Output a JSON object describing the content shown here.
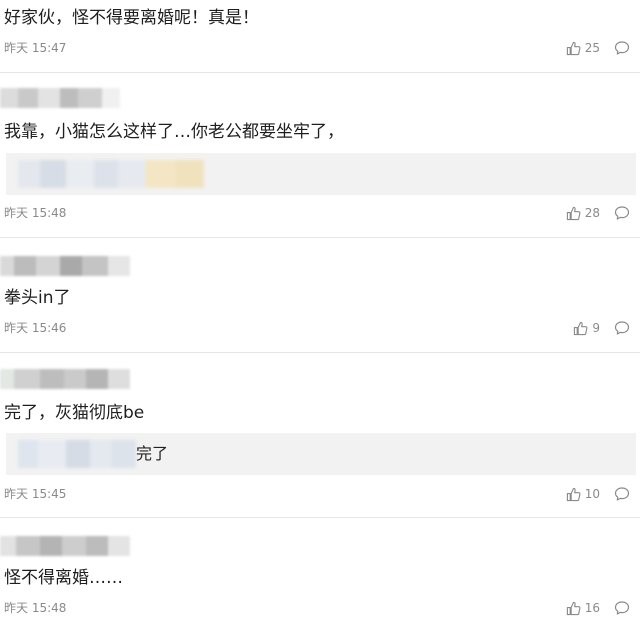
{
  "comments": [
    {
      "text": "好家伙，怪不得要离婚呢！真是！",
      "time": "昨天 15:47",
      "likes": "25"
    },
    {
      "text": "我靠，小猫怎么这样了…你老公都要坐牢了，",
      "time": "昨天 15:48",
      "likes": "28",
      "reply_text": ""
    },
    {
      "text": "拳头in了",
      "time": "昨天 15:46",
      "likes": "9"
    },
    {
      "text": "完了，灰猫彻底be",
      "time": "昨天 15:45",
      "likes": "10",
      "reply_text": "完了"
    },
    {
      "text": "怪不得离婚……",
      "time": "昨天 15:48",
      "likes": "16"
    }
  ],
  "icons": {
    "like": "thumbs-up-icon",
    "reply": "comment-bubble-icon"
  },
  "colors": {
    "meta_text": "#8a8a8a",
    "reply_bg": "#f2f2f2",
    "divider": "#e6e6e6"
  }
}
